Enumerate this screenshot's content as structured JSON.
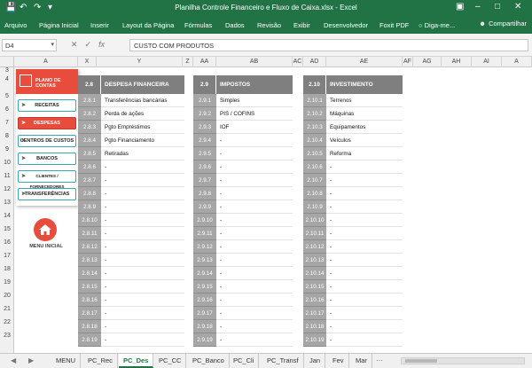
{
  "window": {
    "title": "Planilha Controle Financeiro e Fluxo de Caixa.xlsx - Excel"
  },
  "ribbon": {
    "tabs": [
      "Arquivo",
      "Página Inicial",
      "Inserir",
      "Layout da Página",
      "Fórmulas",
      "Dados",
      "Revisão",
      "Exibir",
      "Desenvolvedor",
      "Foxit PDF"
    ],
    "tell_me": "Diga-me...",
    "share": "Compartilhar"
  },
  "formula_bar": {
    "name_box": "D4",
    "content": "CUSTO COM PRODUTOS"
  },
  "columns": [
    "A",
    "X",
    "Y",
    "Z",
    "AA",
    "AB",
    "AC",
    "AD",
    "AE",
    "AF",
    "AG",
    "AH",
    "AI",
    "A"
  ],
  "rows": [
    "3",
    "4",
    "5",
    "6",
    "7",
    "8",
    "9",
    "10",
    "11",
    "12",
    "13",
    "14",
    "15",
    "16",
    "17",
    "18",
    "19",
    "20",
    "21",
    "22",
    "23"
  ],
  "menu": {
    "header": "PLANO DE CONTAS",
    "items": [
      "RECEITAS",
      "DESPESAS",
      "CENTROS DE CUSTOS",
      "BANCOS",
      "CLIENTES / FORNECEDORES",
      "TRANSFERÊNCIAS"
    ],
    "active_index": 1,
    "home_label": "MENU INICIAL"
  },
  "tables": [
    {
      "code": "2.8",
      "title": "DESPESA FINANCEIRA",
      "rows": [
        {
          "code": "2.8.1",
          "value": "Transferências bancárias"
        },
        {
          "code": "2.8.2",
          "value": "Perda de ações"
        },
        {
          "code": "2.8.3",
          "value": "Pgto Empréstimos"
        },
        {
          "code": "2.8.4",
          "value": "Pgto Financiamento"
        },
        {
          "code": "2.8.5",
          "value": "Retiradas"
        },
        {
          "code": "2.8.6",
          "value": "-"
        },
        {
          "code": "2.8.7",
          "value": "-"
        },
        {
          "code": "2.8.8",
          "value": "-"
        },
        {
          "code": "2.8.9",
          "value": "-"
        },
        {
          "code": "2.8.10",
          "value": "-"
        },
        {
          "code": "2.8.11",
          "value": "-"
        },
        {
          "code": "2.8.12",
          "value": "-"
        },
        {
          "code": "2.8.13",
          "value": "-"
        },
        {
          "code": "2.8.14",
          "value": "-"
        },
        {
          "code": "2.8.15",
          "value": "-"
        },
        {
          "code": "2.8.16",
          "value": "-"
        },
        {
          "code": "2.8.17",
          "value": "-"
        },
        {
          "code": "2.8.18",
          "value": "-"
        },
        {
          "code": "2.8.19",
          "value": "-"
        }
      ]
    },
    {
      "code": "2.9",
      "title": "IMPOSTOS",
      "rows": [
        {
          "code": "2.9.1",
          "value": "Simples"
        },
        {
          "code": "2.9.2",
          "value": "PIS / COFINS"
        },
        {
          "code": "2.9.3",
          "value": "IOF"
        },
        {
          "code": "2.9.4",
          "value": "-"
        },
        {
          "code": "2.9.5",
          "value": "-"
        },
        {
          "code": "2.9.6",
          "value": "-"
        },
        {
          "code": "2.9.7",
          "value": "-"
        },
        {
          "code": "2.9.8",
          "value": "-"
        },
        {
          "code": "2.9.9",
          "value": "-"
        },
        {
          "code": "2.9.10",
          "value": "-"
        },
        {
          "code": "2.9.11",
          "value": "-"
        },
        {
          "code": "2.9.12",
          "value": "-"
        },
        {
          "code": "2.9.13",
          "value": "-"
        },
        {
          "code": "2.9.14",
          "value": "-"
        },
        {
          "code": "2.9.15",
          "value": "-"
        },
        {
          "code": "2.9.16",
          "value": "-"
        },
        {
          "code": "2.9.17",
          "value": "-"
        },
        {
          "code": "2.9.18",
          "value": "-"
        },
        {
          "code": "2.9.19",
          "value": "-"
        }
      ]
    },
    {
      "code": "2.10",
      "title": "INVESTIMENTO",
      "rows": [
        {
          "code": "2.10.1",
          "value": "Terrenos"
        },
        {
          "code": "2.10.2",
          "value": "Máquinas"
        },
        {
          "code": "2.10.3",
          "value": "Equipamentos"
        },
        {
          "code": "2.10.4",
          "value": "Veículos"
        },
        {
          "code": "2.10.5",
          "value": "Reforma"
        },
        {
          "code": "2.10.6",
          "value": "-"
        },
        {
          "code": "2.10.7",
          "value": "-"
        },
        {
          "code": "2.10.8",
          "value": "-"
        },
        {
          "code": "2.10.9",
          "value": "-"
        },
        {
          "code": "2.10.10",
          "value": "-"
        },
        {
          "code": "2.10.11",
          "value": "-"
        },
        {
          "code": "2.10.12",
          "value": "-"
        },
        {
          "code": "2.10.13",
          "value": "-"
        },
        {
          "code": "2.10.14",
          "value": "-"
        },
        {
          "code": "2.10.15",
          "value": "-"
        },
        {
          "code": "2.10.16",
          "value": "-"
        },
        {
          "code": "2.10.17",
          "value": "-"
        },
        {
          "code": "2.10.18",
          "value": "-"
        },
        {
          "code": "2.10.19",
          "value": "-"
        }
      ]
    }
  ],
  "sheet_tabs": {
    "items": [
      "MENU",
      "PC_Rec",
      "PC_Des",
      "PC_CC",
      "PC_Banco",
      "PC_Cli",
      "PC_Transf",
      "Jan",
      "Fev",
      "Mar"
    ],
    "active_index": 2
  },
  "colors": {
    "excel_green": "#217346",
    "accent_red": "#e74c3c",
    "button_border": "#3aa8b5",
    "table_header": "#7f7f7f",
    "code_cell": "#a6a6a6"
  }
}
